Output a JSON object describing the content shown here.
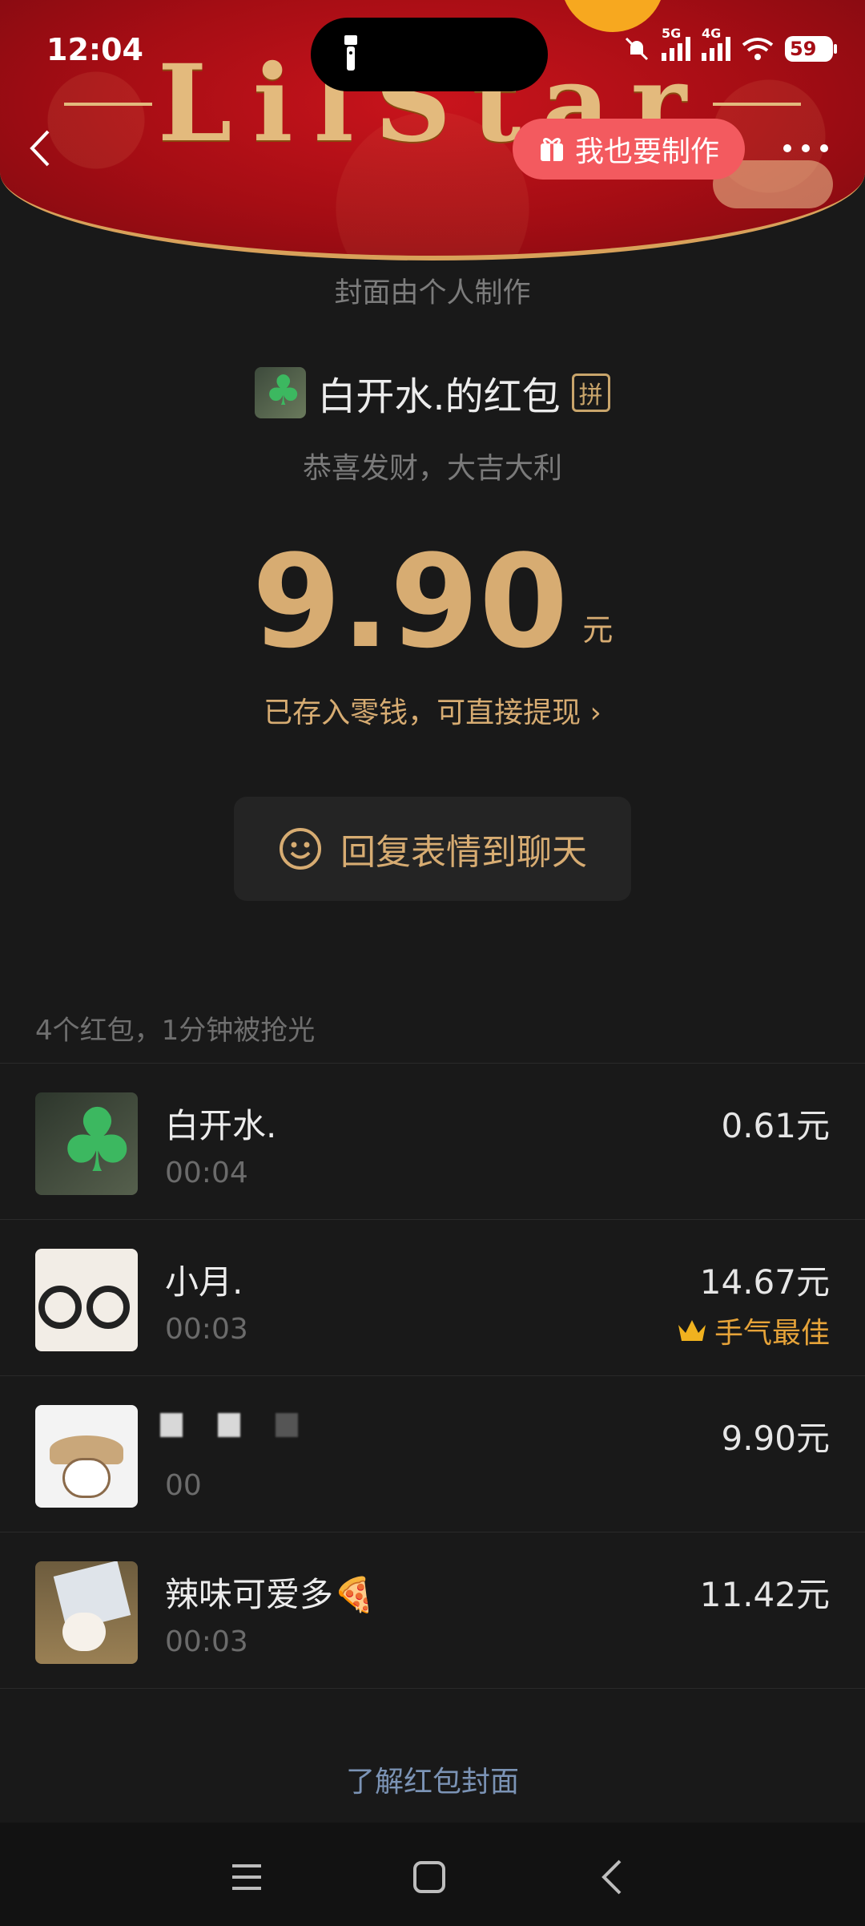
{
  "status_bar": {
    "time": "12:04",
    "network_1": "5G",
    "network_2": "4G",
    "battery": "59"
  },
  "cover": {
    "wordmark": "LilStar",
    "make_button_label": "我也要制作",
    "credit": "封面由个人制作"
  },
  "packet": {
    "sender_title": "白开水.的红包",
    "pin_badge": "拼",
    "blessing": "恭喜发财，大吉大利",
    "amount": "9.90",
    "unit": "元",
    "deposit_link": "已存入零钱，可直接提现 ›",
    "reply_button": "回复表情到聊天"
  },
  "list": {
    "summary": "4个红包，1分钟被抢光",
    "items": [
      {
        "name": "白开水.",
        "time": "00:04",
        "amount": "0.61元"
      },
      {
        "name": "小月.",
        "time": "00:03",
        "amount": "14.67元",
        "badge": "手气最佳"
      },
      {
        "name": "",
        "time": "00",
        "amount": "9.90元"
      },
      {
        "name": "辣味可爱多🍕",
        "time": "00:03",
        "amount": "11.42元"
      }
    ]
  },
  "footer": {
    "link": "了解红包封面"
  },
  "colors": {
    "gold": "#d7ac72",
    "cover_red": "#a50d14",
    "make_button": "#f35a5f",
    "best_luck": "#e6a339"
  }
}
